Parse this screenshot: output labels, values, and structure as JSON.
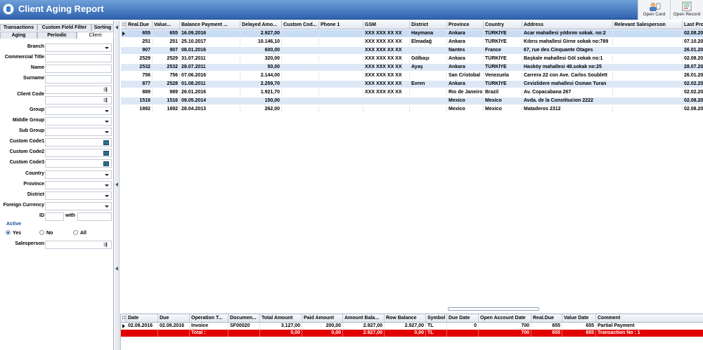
{
  "app": {
    "title": "Client Aging Report"
  },
  "toolbar": {
    "open_card": "Open Card",
    "open_record": "Open Record"
  },
  "tabs_top": [
    "Transactions",
    "Custom Field Filter",
    "Sorting"
  ],
  "tabs_sub": [
    "Aging",
    "Periodic",
    "Client"
  ],
  "form": {
    "branch": "Branch",
    "commercial_title": "Commercial Title",
    "name": "Name",
    "surname": "Surname",
    "client_code": "Client Code",
    "group": "Group",
    "middle_group": "Middle Group",
    "sub_group": "Sub Group",
    "custom_code1": "Custom Code1",
    "custom_code2": "Custom Code2",
    "custom_code3": "Custom Code3",
    "country": "Country",
    "province": "Province",
    "district": "District",
    "foreign_currency": "Foreign Currency",
    "id": "ID",
    "with": "with",
    "active": "Active",
    "yes": "Yes",
    "no": "No",
    "all": "All",
    "salesperson": "Salesperson"
  },
  "main_grid": {
    "columns": [
      "Real.Due",
      "Value...",
      "Balance Payment ...",
      "Delayed Amo...",
      "Custom Cod...",
      "Phone 1",
      "GSM",
      "District",
      "Province",
      "Country",
      "Address",
      "Relevant Salesperson",
      "Last Pro"
    ],
    "rows": [
      [
        "655",
        "655",
        "16.09.2016",
        "2.927,00",
        "",
        "",
        "XXX XXX XX XX",
        "Haymana",
        "Ankara",
        "TÜRKİYE",
        "Acar mahallesi  yıldırım sokak. no:2",
        "",
        "02.08.20"
      ],
      [
        "251",
        "251",
        "25.10.2017",
        "10.146,10",
        "",
        "",
        "XXX XXX XX XX",
        "Elmadağ",
        "Ankara",
        "TÜRKİYE",
        "Kıbrıs mahallesi Girne sokak no:789",
        "",
        "07.10.20"
      ],
      [
        "907",
        "907",
        "08.01.2016",
        "600,00",
        "",
        "",
        "XXX XXX XX XX",
        "",
        "Nantes",
        "France",
        "67, rue des Cinquante Otages",
        "",
        "26.01.20"
      ],
      [
        "2529",
        "2529",
        "31.07.2011",
        "320,00",
        "",
        "",
        "XXX XXX XX XX",
        "Gölbaşı",
        "Ankara",
        "TÜRKİYE",
        "Başkale mahallesi Göl sokak no:1",
        "",
        "02.08.20"
      ],
      [
        "2532",
        "2532",
        "28.07.2011",
        "50,00",
        "",
        "",
        "XXX XXX XX XX",
        "Ayaş",
        "Ankara",
        "TÜRKİYE",
        "Hasköy mahallesi  48.sokak no:25",
        "",
        "28.07.20"
      ],
      [
        "756",
        "756",
        "07.06.2016",
        "2.144,00",
        "",
        "",
        "XXX XXX XX XX",
        "",
        "San Cristobal",
        "Venezuela",
        "Carrera 22 con Ave. Carlos Soublett",
        "",
        "26.01.20"
      ],
      [
        "877",
        "2528",
        "01.08.2011",
        "2.259,70",
        "",
        "",
        "XXX XXX XX XX",
        "Evren",
        "Ankara",
        "TÜRKİYE",
        "Cevizlidere mahallesi Osman Turan",
        "",
        "02.02.20"
      ],
      [
        "889",
        "889",
        "26.01.2016",
        "1.921,70",
        "",
        "",
        "XXX XXX XX XX",
        "",
        "Rio de Janeiro",
        "Brazil",
        "Av. Copacabana 267",
        "",
        "02.02.20"
      ],
      [
        "1516",
        "1516",
        "09.05.2014",
        "150,00",
        "",
        "",
        "",
        "",
        "Mexico",
        "Mexico",
        "Avda. de la Constitucion 2222",
        "",
        "02.08.20"
      ],
      [
        "1892",
        "1892",
        "28.04.2013",
        "262,00",
        "",
        "",
        "",
        "",
        "Mexico",
        "Mexico",
        "Mataderos 2312",
        "",
        "02.08.20"
      ]
    ]
  },
  "detail_grid": {
    "columns": [
      "Date",
      "Due",
      "Operation T...",
      "Documen...",
      "Total Amount",
      "Paid Amount",
      "Amount Bala...",
      "Row Balance",
      "Symbol",
      "Due Date",
      "Open Account Date",
      "Real.Due",
      "Value Date",
      "Comment"
    ],
    "rows": [
      [
        "02.08.2016",
        "02.08.2016",
        "Invoice",
        "SF00020",
        "3.127,00",
        "200,00",
        "2.927,00",
        "2.927,00",
        "TL",
        "0",
        "700",
        "655",
        "655",
        "Partial Payment"
      ]
    ],
    "totals": [
      "",
      "",
      "Total :",
      "",
      "0,00",
      "0,00",
      "2.927,00",
      "0,00",
      "TL",
      "",
      "700",
      "655",
      "655",
      "Transaction No : 1"
    ]
  },
  "colors": {
    "title_bar": "#2f62b0",
    "row_highlight": "#dde8f7",
    "totals_bar": "#e20000"
  }
}
